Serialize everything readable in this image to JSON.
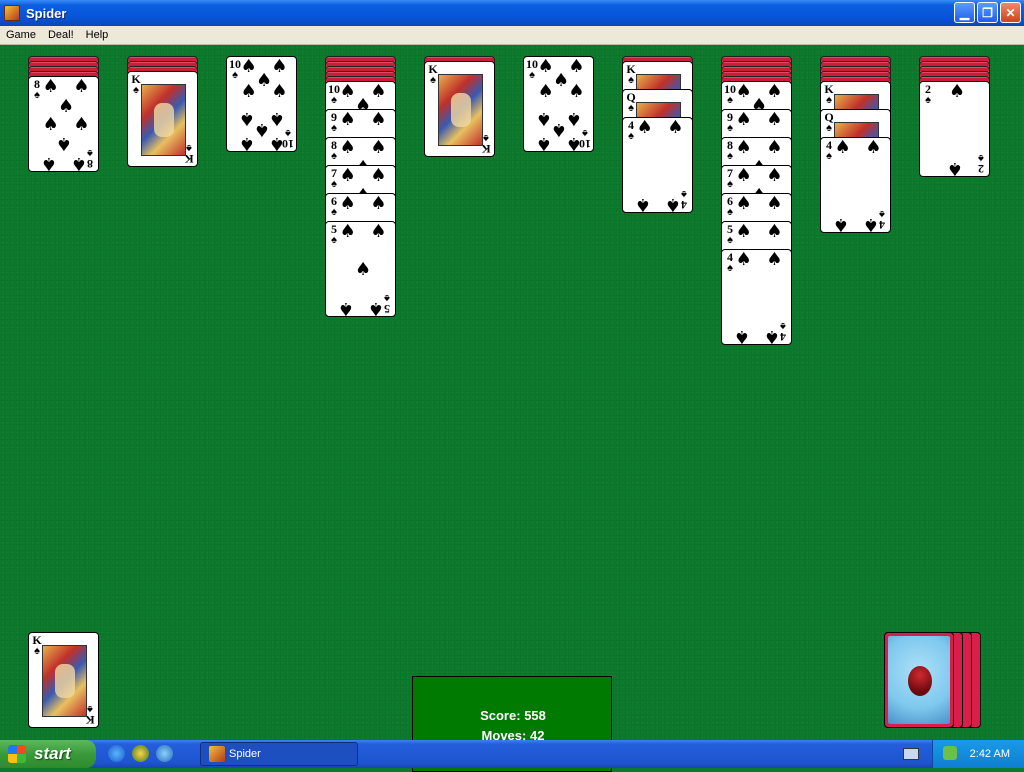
{
  "window": {
    "title": "Spider"
  },
  "menu": {
    "items": [
      "Game",
      "Deal!",
      "Help"
    ]
  },
  "score": {
    "score_label": "Score:",
    "score_value": "558",
    "moves_label": "Moves:",
    "moves_value": "42"
  },
  "tableau": [
    {
      "backs": 4,
      "up": [
        {
          "rank": "8",
          "suit": "♠"
        }
      ]
    },
    {
      "backs": 3,
      "up": [
        {
          "rank": "K",
          "suit": "♠"
        }
      ]
    },
    {
      "backs": 0,
      "up": [
        {
          "rank": "10",
          "suit": "♠"
        }
      ]
    },
    {
      "backs": 5,
      "up": [
        {
          "rank": "10",
          "suit": "♠"
        },
        {
          "rank": "9",
          "suit": "♠"
        },
        {
          "rank": "8",
          "suit": "♠"
        },
        {
          "rank": "7",
          "suit": "♠"
        },
        {
          "rank": "6",
          "suit": "♠"
        },
        {
          "rank": "5",
          "suit": "♠"
        }
      ]
    },
    {
      "backs": 1,
      "up": [
        {
          "rank": "K",
          "suit": "♠"
        }
      ]
    },
    {
      "backs": 0,
      "up": [
        {
          "rank": "10",
          "suit": "♠"
        }
      ]
    },
    {
      "backs": 1,
      "up": [
        {
          "rank": "K",
          "suit": "♠"
        },
        {
          "rank": "Q",
          "suit": "♠"
        },
        {
          "rank": "4",
          "suit": "♠"
        }
      ]
    },
    {
      "backs": 5,
      "up": [
        {
          "rank": "10",
          "suit": "♠"
        },
        {
          "rank": "9",
          "suit": "♠"
        },
        {
          "rank": "8",
          "suit": "♠"
        },
        {
          "rank": "7",
          "suit": "♠"
        },
        {
          "rank": "6",
          "suit": "♠"
        },
        {
          "rank": "5",
          "suit": "♠"
        },
        {
          "rank": "4",
          "suit": "♠"
        }
      ]
    },
    {
      "backs": 5,
      "up": [
        {
          "rank": "K",
          "suit": "♠"
        },
        {
          "rank": "Q",
          "suit": "♠"
        },
        {
          "rank": "4",
          "suit": "♠"
        }
      ]
    },
    {
      "backs": 5,
      "up": [
        {
          "rank": "2",
          "suit": "♠"
        }
      ]
    }
  ],
  "completed": [
    {
      "rank": "K",
      "suit": "♠"
    }
  ],
  "stock": {
    "piles": 4
  },
  "taskbar": {
    "start_label": "start",
    "task_label": "Spider",
    "clock": "2:42 AM"
  },
  "colors": {
    "felt": "#0c7a2c",
    "score_panel": "#007a00",
    "card_back": "#c81e3a"
  },
  "icons": [
    "app-icon",
    "minimize-icon",
    "restore-icon",
    "close-icon",
    "windows-logo-icon",
    "ie-icon",
    "msn-icon",
    "media-player-icon",
    "keyboard-icon",
    "network-icon"
  ]
}
